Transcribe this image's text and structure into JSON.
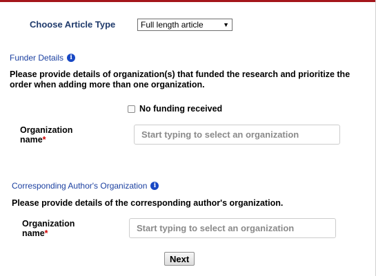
{
  "article_type": {
    "label": "Choose Article Type",
    "selected": "Full length article"
  },
  "funder": {
    "title": "Funder Details",
    "info_icon": "i",
    "description": "Please provide details of organization(s) that funded the research and prioritize the order when adding more than one organization.",
    "no_funding_label": "No funding received",
    "org_label_line1": "Organization",
    "org_label_line2": "name",
    "required_mark": "*",
    "org_placeholder": "Start typing to select an organization"
  },
  "corresponding": {
    "title": "Corresponding Author's Organization",
    "info_icon": "i",
    "description": "Please provide details of the corresponding author's organization.",
    "org_label_line1": "Organization",
    "org_label_line2": "name",
    "required_mark": "*",
    "org_placeholder": "Start typing to select an organization"
  },
  "next_label": "Next",
  "colors": {
    "accent_line": "#a4161b",
    "section_title": "#1a3fa0",
    "heading": "#1f3a6b",
    "required": "#d00000"
  }
}
